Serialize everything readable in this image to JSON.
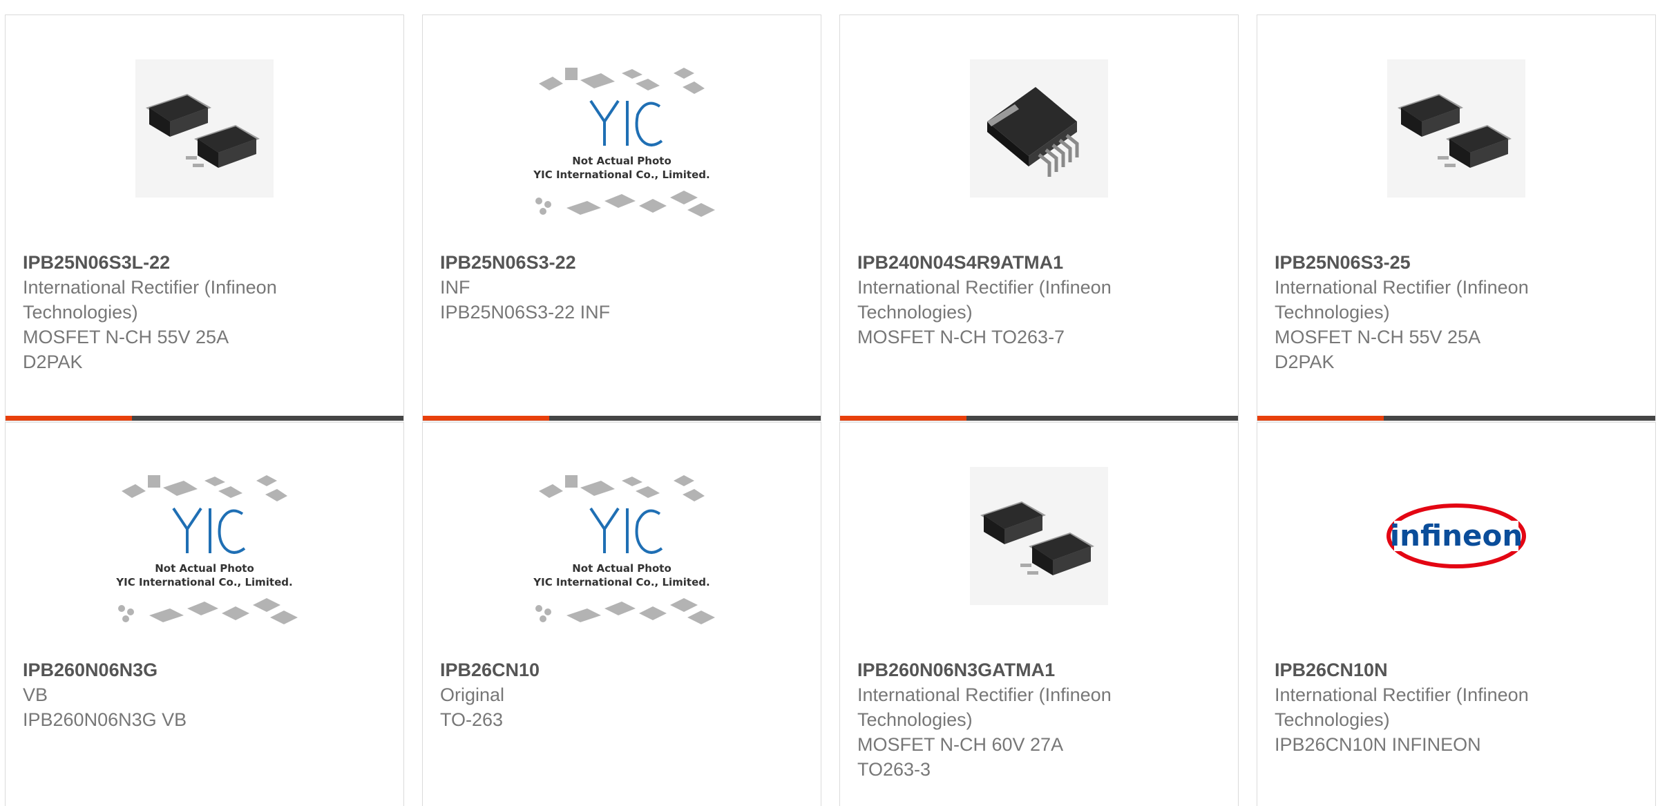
{
  "cards": [
    {
      "part": "IPB25N06S3L-22",
      "maker": "International Rectifier (Infineon Technologies)",
      "desc": "MOSFET N-CH 55V 25A D2PAK",
      "image": "d2pak-photo",
      "caption1": "",
      "caption2": "",
      "bar": true
    },
    {
      "part": "IPB25N06S3-22",
      "maker": "INF",
      "desc": "IPB25N06S3-22 INF",
      "image": "yic-placeholder",
      "caption1": "Not Actual Photo",
      "caption2": "YIC International Co., Limited.",
      "bar": true
    },
    {
      "part": "IPB240N04S4R9ATMA1",
      "maker": "International Rectifier (Infineon Technologies)",
      "desc": "MOSFET N-CH TO263-7",
      "image": "to263-7-photo",
      "caption1": "",
      "caption2": "",
      "bar": true
    },
    {
      "part": "IPB25N06S3-25",
      "maker": "International Rectifier (Infineon Technologies)",
      "desc": "MOSFET N-CH 55V 25A D2PAK",
      "image": "d2pak-photo",
      "caption1": "",
      "caption2": "",
      "bar": true
    },
    {
      "part": "IPB260N06N3G",
      "maker": "VB",
      "desc": "IPB260N06N3G VB",
      "image": "yic-placeholder",
      "caption1": "Not Actual Photo",
      "caption2": "YIC International Co., Limited.",
      "bar": false
    },
    {
      "part": "IPB26CN10",
      "maker": "Original",
      "desc": "TO-263",
      "image": "yic-placeholder",
      "caption1": "Not Actual Photo",
      "caption2": "YIC International Co., Limited.",
      "bar": false
    },
    {
      "part": "IPB260N06N3GATMA1",
      "maker": "International Rectifier (Infineon Technologies)",
      "desc": "MOSFET N-CH 60V 27A TO263-3",
      "image": "d2pak-photo",
      "caption1": "",
      "caption2": "",
      "bar": false
    },
    {
      "part": "IPB26CN10N",
      "maker": "International Rectifier (Infineon Technologies)",
      "desc": "IPB26CN10N INFINEON",
      "image": "infineon-logo",
      "caption1": "",
      "caption2": "",
      "bar": false,
      "logo_text": "infineon"
    }
  ],
  "colors": {
    "accent": "#e8400c",
    "bar": "#454545",
    "yic_blue": "#1f6fb4",
    "infineon_blue": "#0a4d9a",
    "infineon_red": "#e30613"
  }
}
